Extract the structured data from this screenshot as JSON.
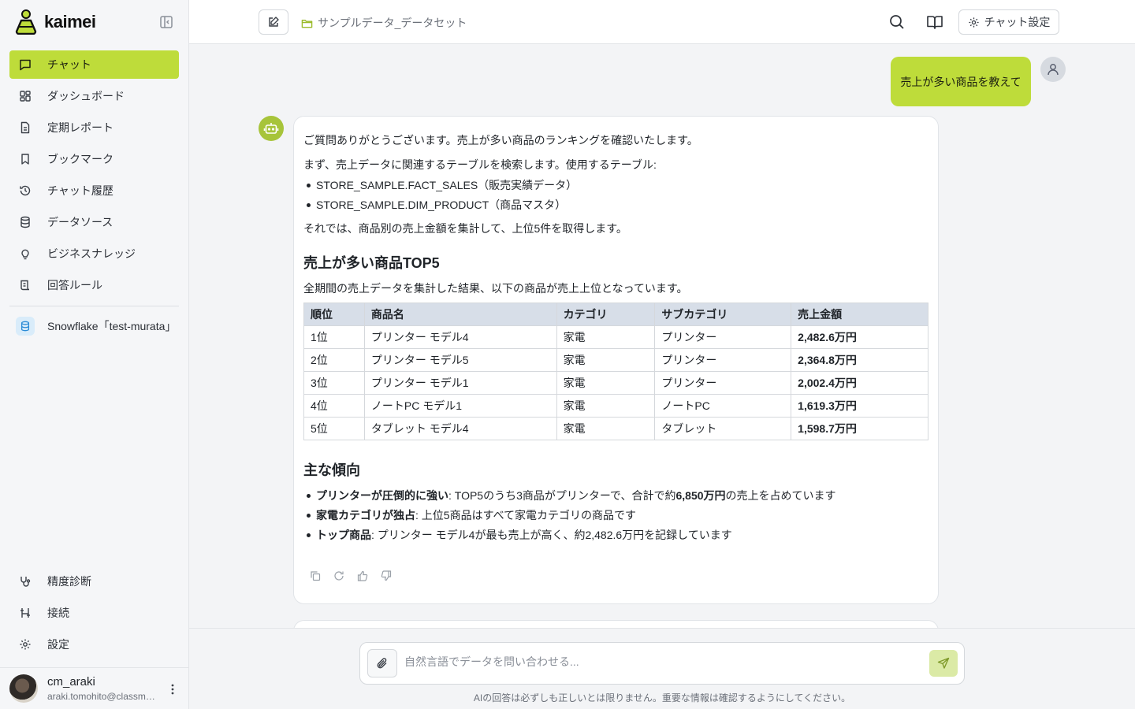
{
  "app": {
    "name": "kaimei"
  },
  "sidebar": {
    "items": [
      {
        "label": "チャット",
        "icon": "chat-icon",
        "active": true
      },
      {
        "label": "ダッシュボード",
        "icon": "dashboard-icon"
      },
      {
        "label": "定期レポート",
        "icon": "report-icon"
      },
      {
        "label": "ブックマーク",
        "icon": "bookmark-icon"
      },
      {
        "label": "チャット履歴",
        "icon": "history-icon"
      },
      {
        "label": "データソース",
        "icon": "database-icon"
      },
      {
        "label": "ビジネスナレッジ",
        "icon": "lightbulb-icon"
      },
      {
        "label": "回答ルール",
        "icon": "rules-icon"
      }
    ],
    "datasource": {
      "label": "Snowflake「test-murata」"
    },
    "bottom_items": [
      {
        "label": "精度診断",
        "icon": "stethoscope-icon"
      },
      {
        "label": "接続",
        "icon": "connection-icon"
      },
      {
        "label": "設定",
        "icon": "gear-icon"
      }
    ],
    "user": {
      "name": "cm_araki",
      "email": "araki.tomohito@classmethod.jp"
    }
  },
  "header": {
    "breadcrumb": "サンプルデータ_データセット",
    "settings_label": "チャット設定"
  },
  "chat": {
    "user_message": "売上が多い商品を教えて",
    "answer": {
      "intro": "ご質問ありがとうございます。売上が多い商品のランキングを確認いたします。",
      "search_text": "まず、売上データに関連するテーブルを検索します。使用するテーブル:",
      "tables_used": [
        "STORE_SAMPLE.FACT_SALES（販売実績データ）",
        "STORE_SAMPLE.DIM_PRODUCT（商品マスタ）"
      ],
      "plan": "それでは、商品別の売上金額を集計して、上位5件を取得します。",
      "heading1": "売上が多い商品TOP5",
      "summary": "全期間の売上データを集計した結果、以下の商品が売上上位となっています。",
      "table": {
        "headers": [
          "順位",
          "商品名",
          "カテゴリ",
          "サブカテゴリ",
          "売上金額"
        ],
        "rows": [
          [
            "1位",
            "プリンター モデル4",
            "家電",
            "プリンター",
            "2,482.6万円"
          ],
          [
            "2位",
            "プリンター モデル5",
            "家電",
            "プリンター",
            "2,364.8万円"
          ],
          [
            "3位",
            "プリンター モデル1",
            "家電",
            "プリンター",
            "2,002.4万円"
          ],
          [
            "4位",
            "ノートPC モデル1",
            "家電",
            "ノートPC",
            "1,619.3万円"
          ],
          [
            "5位",
            "タブレット モデル4",
            "家電",
            "タブレット",
            "1,598.7万円"
          ]
        ]
      },
      "heading2": "主な傾向",
      "trends": [
        {
          "bold": "プリンターが圧倒的に強い",
          "text_a": ": TOP5のうち3商品がプリンターで、合計で約",
          "bold2": "6,850万円",
          "text_b": "の売上を占めています"
        },
        {
          "bold": "家電カテゴリが独占",
          "text_a": ": 上位5商品はすべて家電カテゴリの商品です"
        },
        {
          "bold": "トップ商品",
          "text_a": ": プリンター モデル4が最も売上が高く、約2,482.6万円を記録しています"
        }
      ]
    }
  },
  "composer": {
    "placeholder": "自然言語でデータを問い合わせる...",
    "disclaimer": "AIの回答は必ずしも正しいとは限りません。重要な情報は確認するようにしてください。"
  }
}
